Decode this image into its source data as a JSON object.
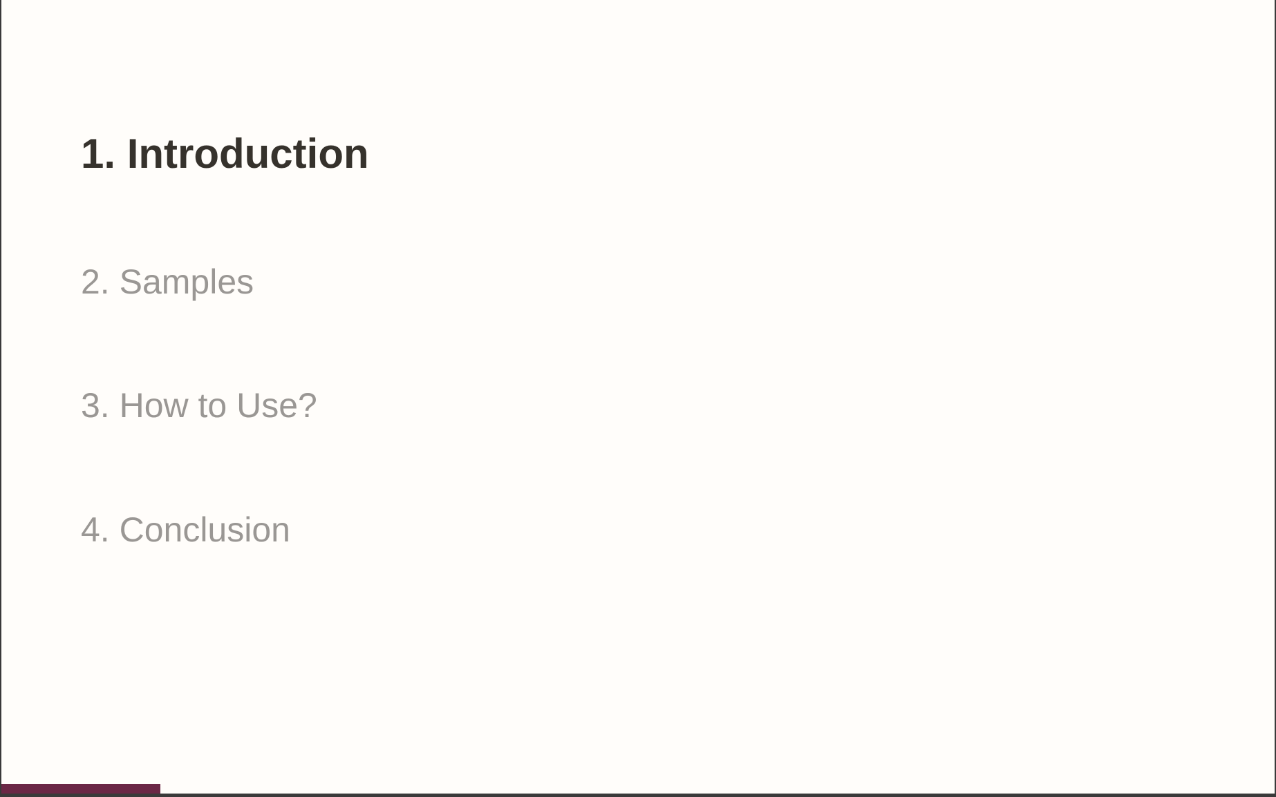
{
  "toc": {
    "items": [
      {
        "label": "1. Introduction",
        "active": true
      },
      {
        "label": "2. Samples",
        "active": false
      },
      {
        "label": "3. How to Use?",
        "active": false
      },
      {
        "label": "4. Conclusion",
        "active": false
      }
    ]
  },
  "progress": {
    "fraction": 0.125,
    "color": "#6b2745"
  },
  "colors": {
    "background": "#fffdfa",
    "active_text": "#36322c",
    "inactive_text": "#9a9794",
    "frame": "#3a3a3a"
  }
}
